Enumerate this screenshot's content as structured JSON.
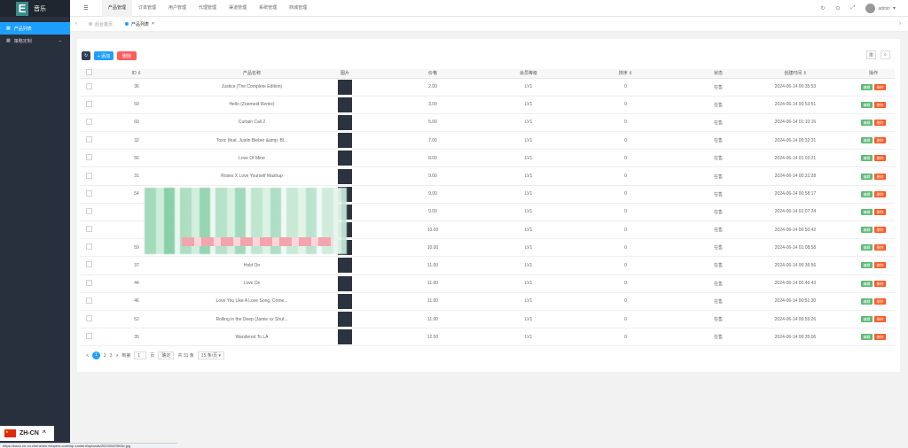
{
  "app": {
    "logo_letter": "E",
    "title": "音乐"
  },
  "sidebar": {
    "items": [
      {
        "label": "产品列表",
        "icon": "grid-icon"
      },
      {
        "label": "策略定制",
        "icon": "grid-icon"
      }
    ]
  },
  "topnav": {
    "items": [
      "产品管理",
      "订单管理",
      "用户管理",
      "代理管理",
      "渠道管理",
      "系统管理",
      "商城管理"
    ],
    "active": "产品管理",
    "user": "admin"
  },
  "tabs": {
    "home": "后台首页",
    "current": "产品列表"
  },
  "toolbar": {
    "add": "+ 添加",
    "delete": "删除"
  },
  "table": {
    "headers": [
      "ID",
      "产品名称",
      "图片",
      "价格",
      "会员等级",
      "排序",
      "状态",
      "创建时间",
      "操作"
    ],
    "edit_label": "编辑",
    "delete_label": "删除",
    "rows": [
      {
        "id": "36",
        "name": "Justice (The Complete Edition)",
        "price": "2.00",
        "level": "LV1",
        "sort": "0",
        "status": "在售",
        "created": "2024-06-14 00:35:53"
      },
      {
        "id": "50",
        "name": "Hello (Zoemeid Remix)",
        "price": "3.00",
        "level": "LV1",
        "sort": "0",
        "status": "在售",
        "created": "2024-06-14 00:53:51"
      },
      {
        "id": "60",
        "name": "Curtain Call 2",
        "price": "5.00",
        "level": "LV1",
        "sort": "0",
        "status": "在售",
        "created": "2024-06-14 01:10:16"
      },
      {
        "id": "32",
        "name": "Toxic (feat. Justin Bieber &amp; Bl...",
        "price": "7.00",
        "level": "LV1",
        "sort": "0",
        "status": "在售",
        "created": "2024-06-14 00:32:31"
      },
      {
        "id": "56",
        "name": "Love Of Mine",
        "price": "8.00",
        "level": "LV1",
        "sort": "0",
        "status": "在售",
        "created": "2024-06-14 01:03:21"
      },
      {
        "id": "31",
        "name": "Roses X Love Yourself Mashup",
        "price": "9.00",
        "level": "LV1",
        "sort": "0",
        "status": "在售",
        "created": "2024-06-14 00:31:28"
      },
      {
        "id": "54",
        "name": "",
        "price": "9.00",
        "level": "LV1",
        "sort": "0",
        "status": "在售",
        "created": "2024-06-14 00:58:17"
      },
      {
        "id": "",
        "name": "",
        "price": "9.00",
        "level": "LV1",
        "sort": "0",
        "status": "在售",
        "created": "2024-06-14 01:07:24"
      },
      {
        "id": "",
        "name": "",
        "price": "10.00",
        "level": "LV1",
        "sort": "0",
        "status": "在售",
        "created": "2024-06-14 00:50:42"
      },
      {
        "id": "59",
        "name": "",
        "price": "10.00",
        "level": "LV1",
        "sort": "0",
        "status": "在售",
        "created": "2024-06-14 01:08:58"
      },
      {
        "id": "37",
        "name": "Hold On",
        "price": "11.00",
        "level": "LV1",
        "sort": "0",
        "status": "在售",
        "created": "2024-06-14 00:36:56"
      },
      {
        "id": "44",
        "name": "Love On",
        "price": "11.00",
        "level": "LV1",
        "sort": "0",
        "status": "在售",
        "created": "2024-06-14 00:46:43"
      },
      {
        "id": "46",
        "name": "Love You Like A Love Song, Come...",
        "price": "11.00",
        "level": "LV1",
        "sort": "0",
        "status": "在售",
        "created": "2024-06-14 00:51:30"
      },
      {
        "id": "52",
        "name": "Rolling in the Deep (Jamie xx Shuf...",
        "price": "11.00",
        "level": "LV1",
        "sort": "0",
        "status": "在售",
        "created": "2024-06-14 00:55:26"
      },
      {
        "id": "35",
        "name": "Wandered To LA",
        "price": "12.00",
        "level": "LV1",
        "sort": "0",
        "status": "在售",
        "created": "2024-06-14 00:35:06"
      }
    ]
  },
  "pagination": {
    "prev": "<",
    "pages": [
      "1",
      "2",
      "3"
    ],
    "next": ">",
    "goto": "到第",
    "page_value": "1",
    "page_unit": "页",
    "confirm": "确定",
    "total": "共 31 条",
    "per_page": "15 条/页"
  },
  "language": {
    "code": "ZH-CN"
  },
  "statusbar": {
    "url": "https://kwcc.cn-cn.chenzhen.eliopers.com/wp-content/uploads/2024/04/0903e.jpg"
  }
}
